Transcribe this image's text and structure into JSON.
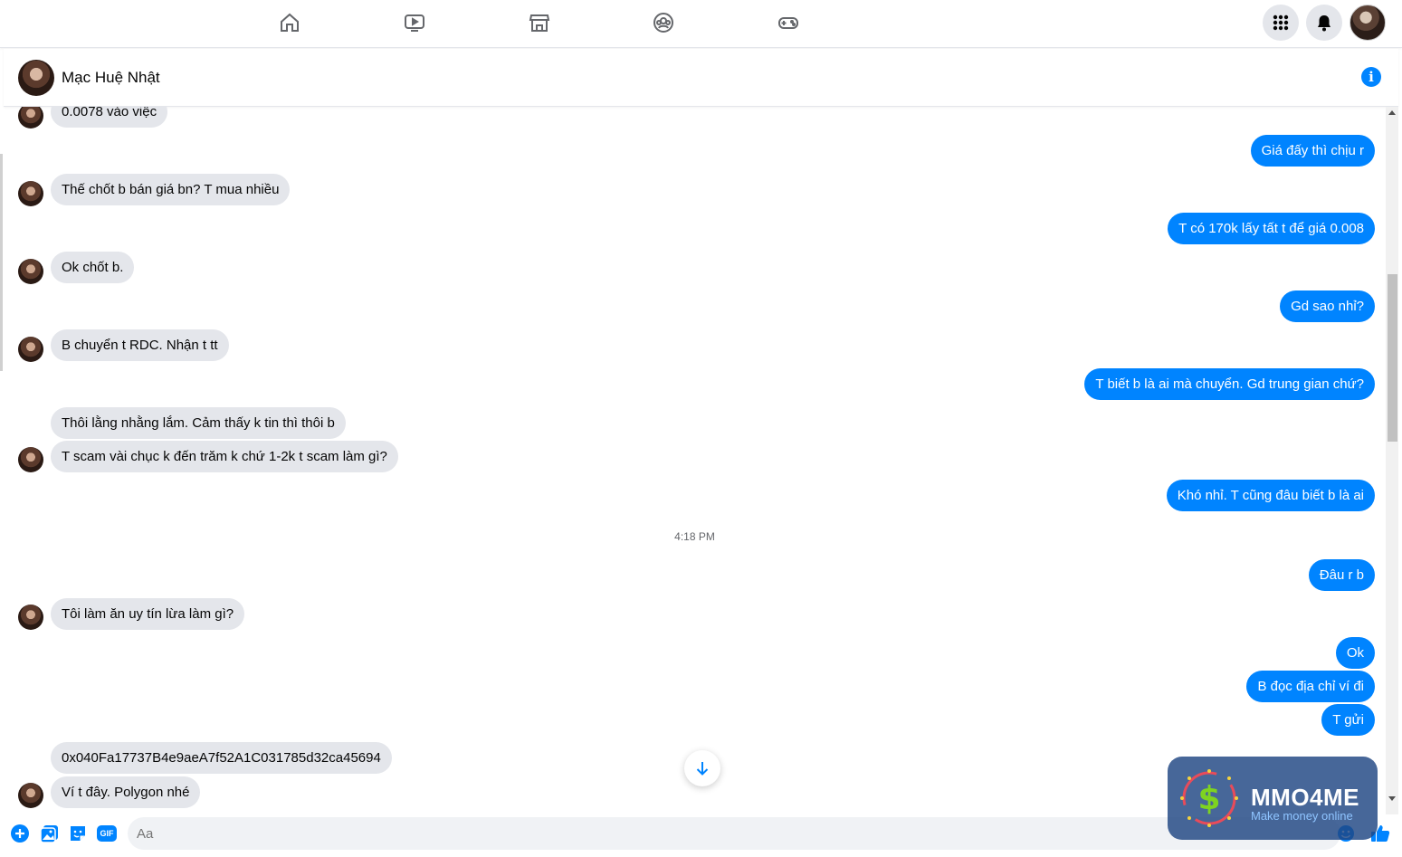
{
  "top_nav": {
    "icons": [
      "home-icon",
      "watch-icon",
      "marketplace-icon",
      "groups-icon",
      "gaming-icon"
    ],
    "right_icons": [
      "menu-grid-icon",
      "notifications-icon"
    ],
    "account_avatar": "profile-avatar"
  },
  "chat": {
    "contact_name": "Mạc Huệ Nhật",
    "info_icon": "i"
  },
  "messages": {
    "m1": "0.0078 vào việc",
    "m2": "Giá đấy thì chịu r",
    "m3": "Thế chốt b bán giá bn? T mua nhiều",
    "m4": "T có 170k lấy tất t để giá 0.008",
    "m5": "Ok chốt b.",
    "m6": "Gd sao nhỉ?",
    "m7": "B chuyển t RDC. Nhận t tt",
    "m8": "T biết b là ai mà chuyển. Gd trung gian chứ?",
    "m9": "Thôi lằng nhằng lắm. Cảm thấy k tin thì thôi b",
    "m10": "T scam vài chục k đến trăm k chứ 1-2k t scam làm gì?",
    "m11": "Khó nhỉ. T cũng đâu biết b là ai",
    "timestamp": "4:18 PM",
    "m12": "Đâu r b",
    "m13": "Tôi làm ăn uy tín lừa làm gì?",
    "m14": "Ok",
    "m15": "B đọc địa chỉ ví đi",
    "m16": "T gửi",
    "m17": "0x040Fa17737B4e9aeA7f52A1C031785d32ca45694",
    "m18": "Ví t đây. Polygon nhé"
  },
  "composer": {
    "placeholder": "Aa",
    "icons": [
      "add-icon",
      "photo-icon",
      "sticker-icon",
      "gif-icon",
      "emoji-icon",
      "like-icon"
    ],
    "gif_label": "GIF"
  },
  "watermark": {
    "title": "MMO4ME",
    "subtitle": "Make money online"
  },
  "colors": {
    "accent": "#0084ff",
    "incoming_bubble": "#e4e6eb",
    "outgoing_bubble": "#0084ff"
  }
}
